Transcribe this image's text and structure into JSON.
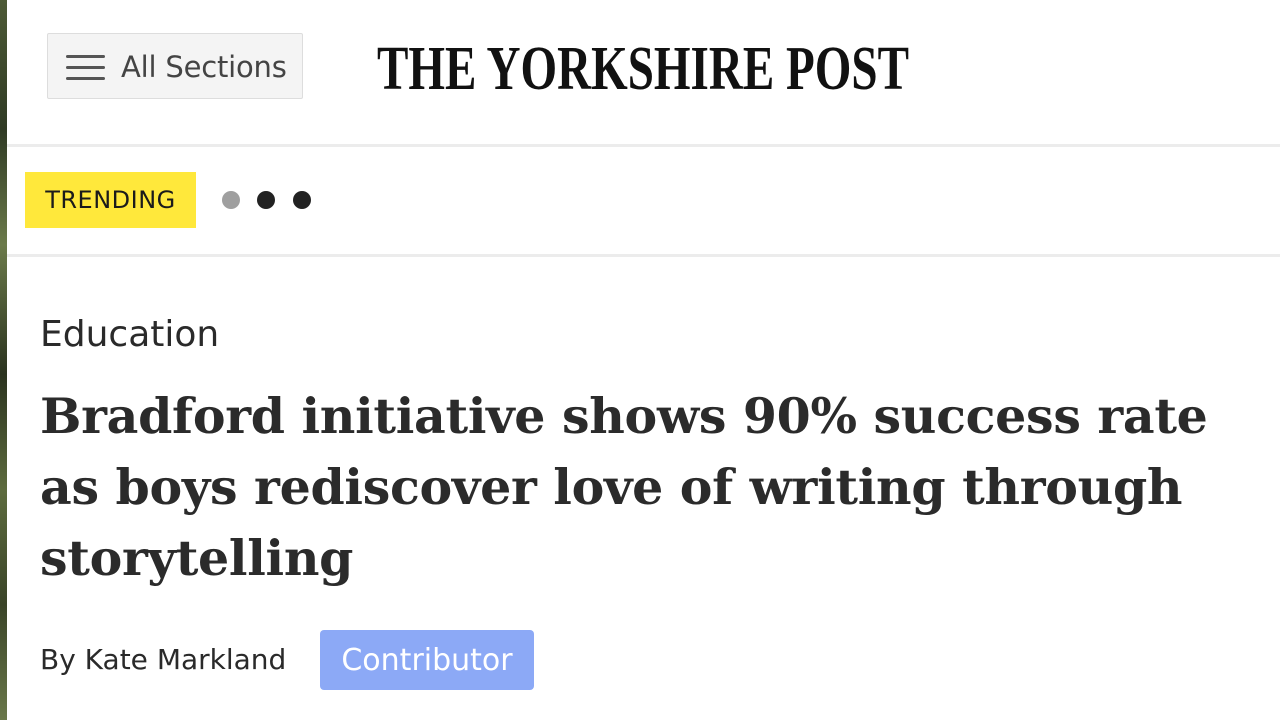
{
  "header": {
    "menu_label": "All Sections",
    "menu_icon": "hamburger-icon",
    "logo_text": "THE YORKSHIRE POST"
  },
  "trending": {
    "label": "TRENDING",
    "badge_color": "#ffe83b",
    "carousel_dots": 3,
    "active_dot": 1
  },
  "article": {
    "category": "Education",
    "headline": "Bradford initiative shows 90% success rate as boys rediscover love of writing through storytelling",
    "byline": "By Kate Markland",
    "author_role": "Contributor",
    "role_badge_color": "#8ca9f6"
  }
}
